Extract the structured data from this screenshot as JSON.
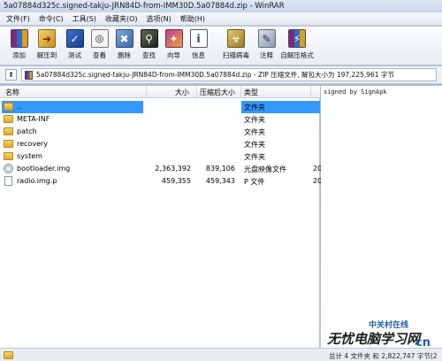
{
  "window": {
    "title": "5a07884d325c.signed-takju-JRN84D-from-IMM30D.5a07884d.zip - WinRAR"
  },
  "menu": [
    "文件(F)",
    "命令(C)",
    "工具(S)",
    "收藏夹(O)",
    "选项(N)",
    "帮助(H)"
  ],
  "toolbar": [
    {
      "label": "添加",
      "icon": "add-archive-icon"
    },
    {
      "label": "解压到",
      "icon": "extract-to-icon"
    },
    {
      "label": "测试",
      "icon": "test-icon"
    },
    {
      "label": "查看",
      "icon": "view-icon"
    },
    {
      "label": "删除",
      "icon": "delete-icon"
    },
    {
      "label": "查找",
      "icon": "find-icon"
    },
    {
      "label": "向导",
      "icon": "wizard-icon"
    },
    {
      "label": "信息",
      "icon": "info-icon"
    },
    {
      "label": "扫描病毒",
      "icon": "virus-scan-icon"
    },
    {
      "label": "注释",
      "icon": "comment-icon"
    },
    {
      "label": "自解压格式",
      "icon": "sfx-icon"
    }
  ],
  "address": {
    "text": "5a07884d325c.signed-takju-JRN84D-from-IMM30D.5a07884d.zip - ZIP 压缩文件, 解包大小为 197,225,961 字节"
  },
  "columns": {
    "name": "名称",
    "size": "大小",
    "packed": "压缩后大小",
    "type": "类型"
  },
  "files": [
    {
      "name": "..",
      "size": "",
      "packed": "",
      "type": "文件夹",
      "extra": "",
      "icon": "folder-icon",
      "selected": true
    },
    {
      "name": "META-INF",
      "size": "",
      "packed": "",
      "type": "文件夹",
      "extra": "",
      "icon": "folder-icon"
    },
    {
      "name": "patch",
      "size": "",
      "packed": "",
      "type": "文件夹",
      "extra": "",
      "icon": "folder-icon"
    },
    {
      "name": "recovery",
      "size": "",
      "packed": "",
      "type": "文件夹",
      "extra": "",
      "icon": "folder-icon"
    },
    {
      "name": "system",
      "size": "",
      "packed": "",
      "type": "文件夹",
      "extra": "",
      "icon": "folder-icon"
    },
    {
      "name": "bootloader.img",
      "size": "2,363,392",
      "packed": "839,106",
      "type": "光盘映像文件",
      "extra": "20",
      "icon": "disc-image-icon"
    },
    {
      "name": "radio.img.p",
      "size": "459,355",
      "packed": "459,343",
      "type": "P 文件",
      "extra": "20",
      "icon": "file-icon"
    }
  ],
  "comment": {
    "text": "signed by SignApk"
  },
  "status": {
    "text": "总计 4 文件夹 和 2,822,747 字节(2"
  },
  "watermark": {
    "main": "无忧电脑学习网",
    "sub": "中关村在线",
    "domain": "cn"
  }
}
